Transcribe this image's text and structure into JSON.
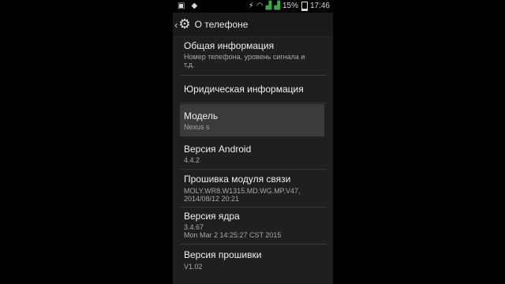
{
  "status_bar": {
    "battery": "15%",
    "time": "17:46",
    "icons": [
      "screenshot-icon",
      "android-icon",
      "usb-icon",
      "wifi-icon",
      "signal-icon",
      "signal-icon",
      "battery-icon"
    ]
  },
  "action_bar": {
    "title": "О телефоне",
    "icon": "gear-icon"
  },
  "items": [
    {
      "title": "Общая информация",
      "subtitle": [
        "Номер телефона, уровень сигнала и",
        "т.д."
      ]
    },
    {
      "title": "Юридическая информация",
      "subtitle": []
    },
    {
      "title": "Модель",
      "subtitle": [
        "Nexus s"
      ],
      "selected": true
    },
    {
      "title": "Версия Android",
      "subtitle": [
        "4.4.2"
      ]
    },
    {
      "title": "Прошивка модуля связи",
      "subtitle": [
        "MOLY.WR8.W1315.MD.WG.MP.V47,",
        "2014/08/12 20:21"
      ]
    },
    {
      "title": "Версия ядра",
      "subtitle": [
        "3.4.67",
        "Mon Mar 2 14:25:27 CST 2015"
      ]
    },
    {
      "title": "Версия прошивки",
      "subtitle": [
        "V1.02"
      ]
    }
  ],
  "colors": {
    "background": "#1f1f1f",
    "selected": "#3b3b3b",
    "signal": "#3aa64a"
  }
}
